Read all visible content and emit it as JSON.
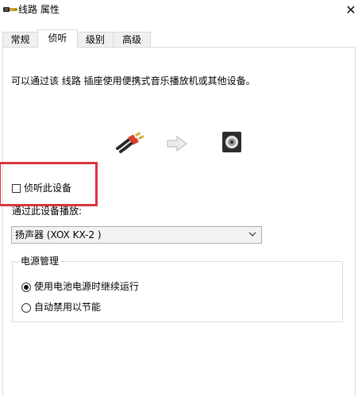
{
  "window": {
    "title": "线路 属性",
    "close_glyph": "✕"
  },
  "tabs": [
    {
      "label": "常规",
      "active": false
    },
    {
      "label": "侦听",
      "active": true
    },
    {
      "label": "级别",
      "active": false
    },
    {
      "label": "高级",
      "active": false
    }
  ],
  "listen": {
    "description": "可以通过该 线路 插座使用便携式音乐播放机或其他设备。",
    "checkbox_label": "侦听此设备",
    "checkbox_checked": false,
    "playback_label": "通过此设备播放:",
    "playback_device": "扬声器 (XOX KX-2 )"
  },
  "power": {
    "group_title": "电源管理",
    "options": [
      {
        "label": "使用电池电源时继续运行",
        "selected": true
      },
      {
        "label": "自动禁用以节能",
        "selected": false
      }
    ]
  },
  "icons": {
    "title_icon": "line-in-jack-icon",
    "cable": "audio-cable-icon",
    "arrow": "arrow-right-icon",
    "speaker": "speaker-icon",
    "chevron": "chevron-down-icon"
  },
  "colors": {
    "highlight": "#d9363e",
    "tab_border": "#d9d9d9",
    "select_bg": "#f3f3f3"
  }
}
